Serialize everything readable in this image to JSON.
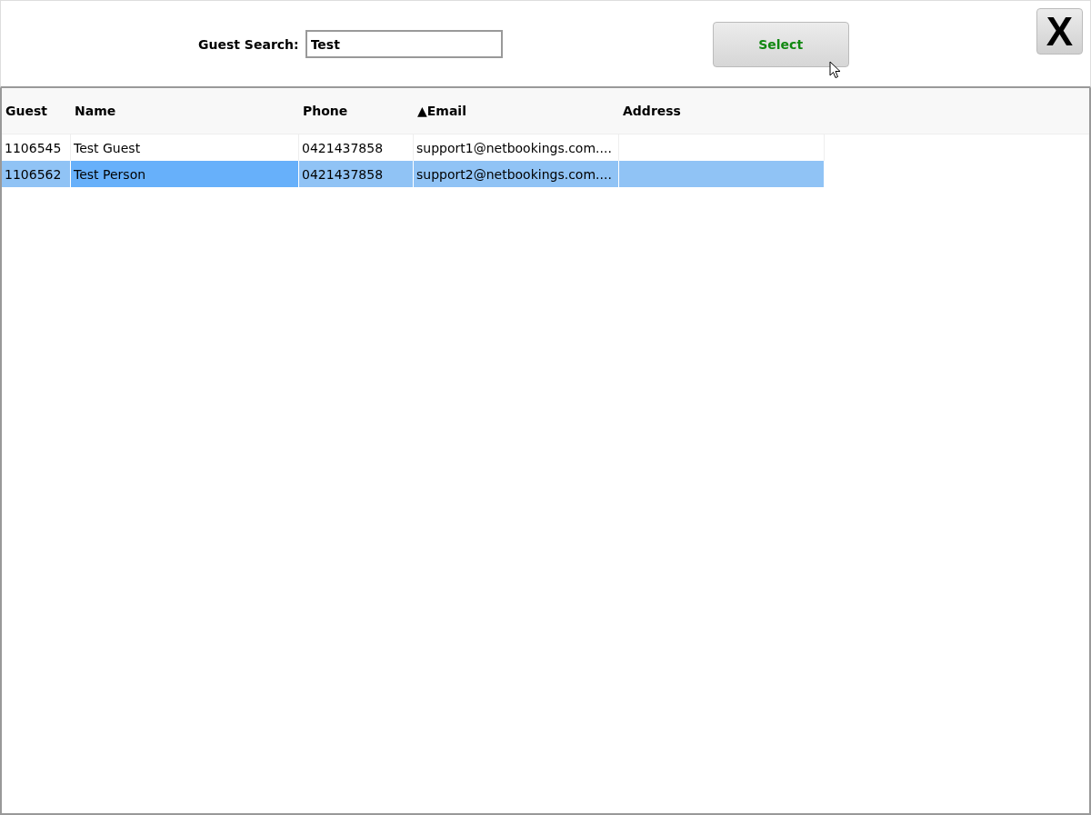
{
  "search": {
    "label": "Guest Search:",
    "value": "Test"
  },
  "select_button": "Select",
  "close_button": "X",
  "table": {
    "columns": [
      "Guest",
      "Name",
      "Phone",
      "▲Email",
      "Address"
    ],
    "rows": [
      {
        "selected": false,
        "cells": [
          {
            "text": "1106545",
            "focused": false
          },
          {
            "text": "Test Guest",
            "focused": false
          },
          {
            "text": "0421437858",
            "focused": false
          },
          {
            "text": "support1@netbookings.com....",
            "focused": false
          },
          {
            "text": "",
            "focused": false
          }
        ]
      },
      {
        "selected": true,
        "cells": [
          {
            "text": "1106562",
            "focused": false
          },
          {
            "text": "Test Person",
            "focused": true
          },
          {
            "text": "0421437858",
            "focused": false
          },
          {
            "text": "support2@netbookings.com....",
            "focused": false
          },
          {
            "text": "",
            "focused": false
          }
        ]
      }
    ]
  }
}
